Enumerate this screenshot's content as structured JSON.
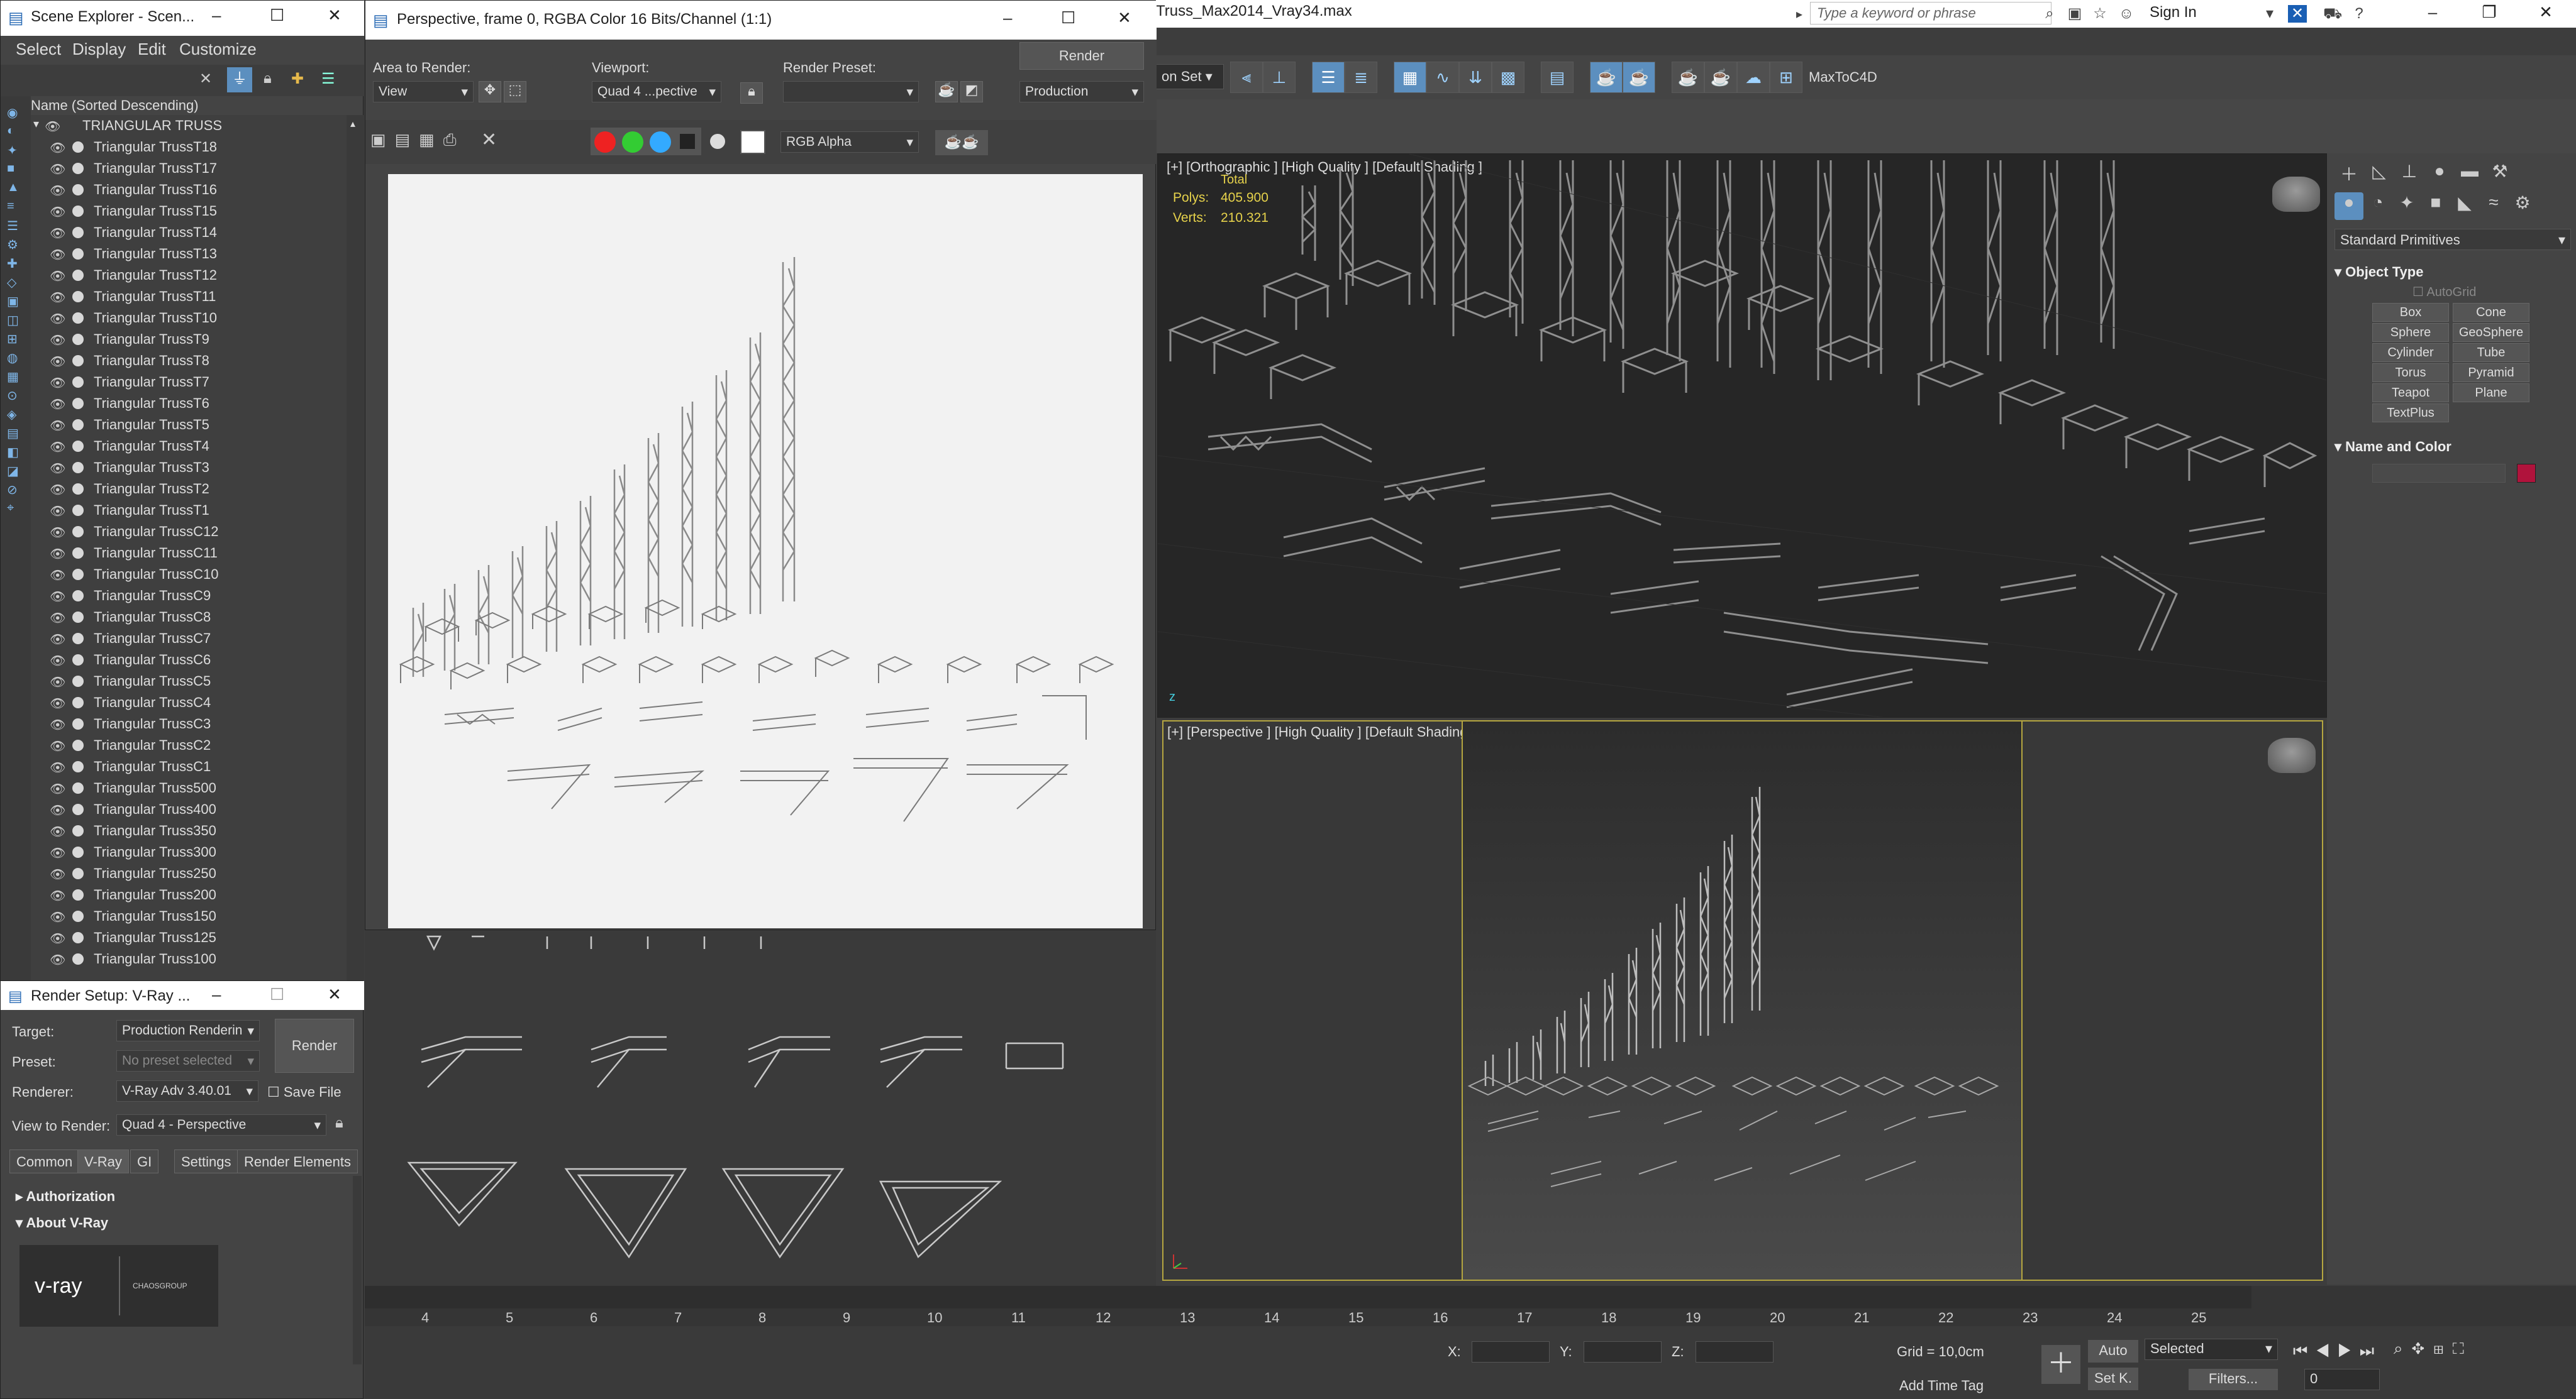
{
  "app": {
    "file_title": "Truss_Max2014_Vray34.max",
    "search_placeholder": "Type a keyword or phrase",
    "sign_in": "Sign In",
    "selection_set": "on Set",
    "plugin_label": "MaxToC4D"
  },
  "scene_explorer": {
    "title": "Scene Explorer - Scen...",
    "menu": [
      "Select",
      "Display",
      "Edit",
      "Customize"
    ],
    "column_header": "Name (Sorted Descending)",
    "root": "TRIANGULAR TRUSS",
    "items": [
      "Triangular TrussT18",
      "Triangular TrussT17",
      "Triangular TrussT16",
      "Triangular TrussT15",
      "Triangular TrussT14",
      "Triangular TrussT13",
      "Triangular TrussT12",
      "Triangular TrussT11",
      "Triangular TrussT10",
      "Triangular TrussT9",
      "Triangular TrussT8",
      "Triangular TrussT7",
      "Triangular TrussT6",
      "Triangular TrussT5",
      "Triangular TrussT4",
      "Triangular TrussT3",
      "Triangular TrussT2",
      "Triangular TrussT1",
      "Triangular TrussC12",
      "Triangular TrussC11",
      "Triangular TrussC10",
      "Triangular TrussC9",
      "Triangular TrussC8",
      "Triangular TrussC7",
      "Triangular TrussC6",
      "Triangular TrussC5",
      "Triangular TrussC4",
      "Triangular TrussC3",
      "Triangular TrussC2",
      "Triangular TrussC1",
      "Triangular Truss500",
      "Triangular Truss400",
      "Triangular Truss350",
      "Triangular Truss300",
      "Triangular Truss250",
      "Triangular Truss200",
      "Triangular Truss150",
      "Triangular Truss125",
      "Triangular Truss100"
    ]
  },
  "frame_buffer": {
    "title": "Perspective, frame 0, RGBA Color 16 Bits/Channel (1:1)",
    "area_to_render_label": "Area to Render:",
    "area_to_render_value": "View",
    "viewport_label": "Viewport:",
    "viewport_value": "Quad 4 ...pective",
    "render_preset_label": "Render Preset:",
    "render_preset_value": "",
    "render_button": "Render",
    "production_value": "Production",
    "channel_value": "RGB Alpha"
  },
  "render_setup": {
    "title": "Render Setup: V-Ray ...",
    "target_label": "Target:",
    "target_value": "Production Renderin",
    "preset_label": "Preset:",
    "preset_value": "No preset selected",
    "renderer_label": "Renderer:",
    "renderer_value": "V-Ray Adv 3.40.01",
    "save_file": "Save File",
    "render_button": "Render",
    "view_to_render_label": "View to Render:",
    "view_to_render_value": "Quad 4 - Perspective",
    "tabs": [
      "Common",
      "V-Ray",
      "GI",
      "Settings",
      "Render Elements"
    ],
    "rollouts": [
      "Authorization",
      "About V-Ray"
    ],
    "vray_logo": "v-ray",
    "chaos_logo": "CHAOSGROUP"
  },
  "viewports": {
    "top": {
      "label": "[+] [Orthographic ] [High Quality ] [Default Shading ]",
      "stats_total": "Total",
      "polys_label": "Polys:",
      "polys_value": "405.900",
      "verts_label": "Verts:",
      "verts_value": "210.321"
    },
    "bottom": {
      "label": "[+] [Perspective ] [High Quality ] [Default Shading ]"
    }
  },
  "command_panel": {
    "category": "Standard Primitives",
    "object_type_header": "Object Type",
    "autogrid": "AutoGrid",
    "buttons": [
      "Box",
      "Cone",
      "Sphere",
      "GeoSphere",
      "Cylinder",
      "Tube",
      "Torus",
      "Pyramid",
      "Teapot",
      "Plane",
      "TextPlus"
    ],
    "name_color_header": "Name and Color",
    "swatch_color": "#b0133c"
  },
  "timeline": {
    "ticks": [
      "4",
      "5",
      "6",
      "7",
      "8",
      "9",
      "10",
      "11",
      "12",
      "13",
      "14",
      "15",
      "16",
      "17",
      "18",
      "19",
      "20",
      "21",
      "22",
      "23",
      "24",
      "25"
    ]
  },
  "status": {
    "x_label": "X:",
    "y_label": "Y:",
    "z_label": "Z:",
    "grid": "Grid = 10,0cm",
    "add_time_tag": "Add Time Tag",
    "auto": "Auto",
    "set_key": "Set K.",
    "selected": "Selected",
    "filters": "Filters...",
    "frame_value": "0"
  }
}
